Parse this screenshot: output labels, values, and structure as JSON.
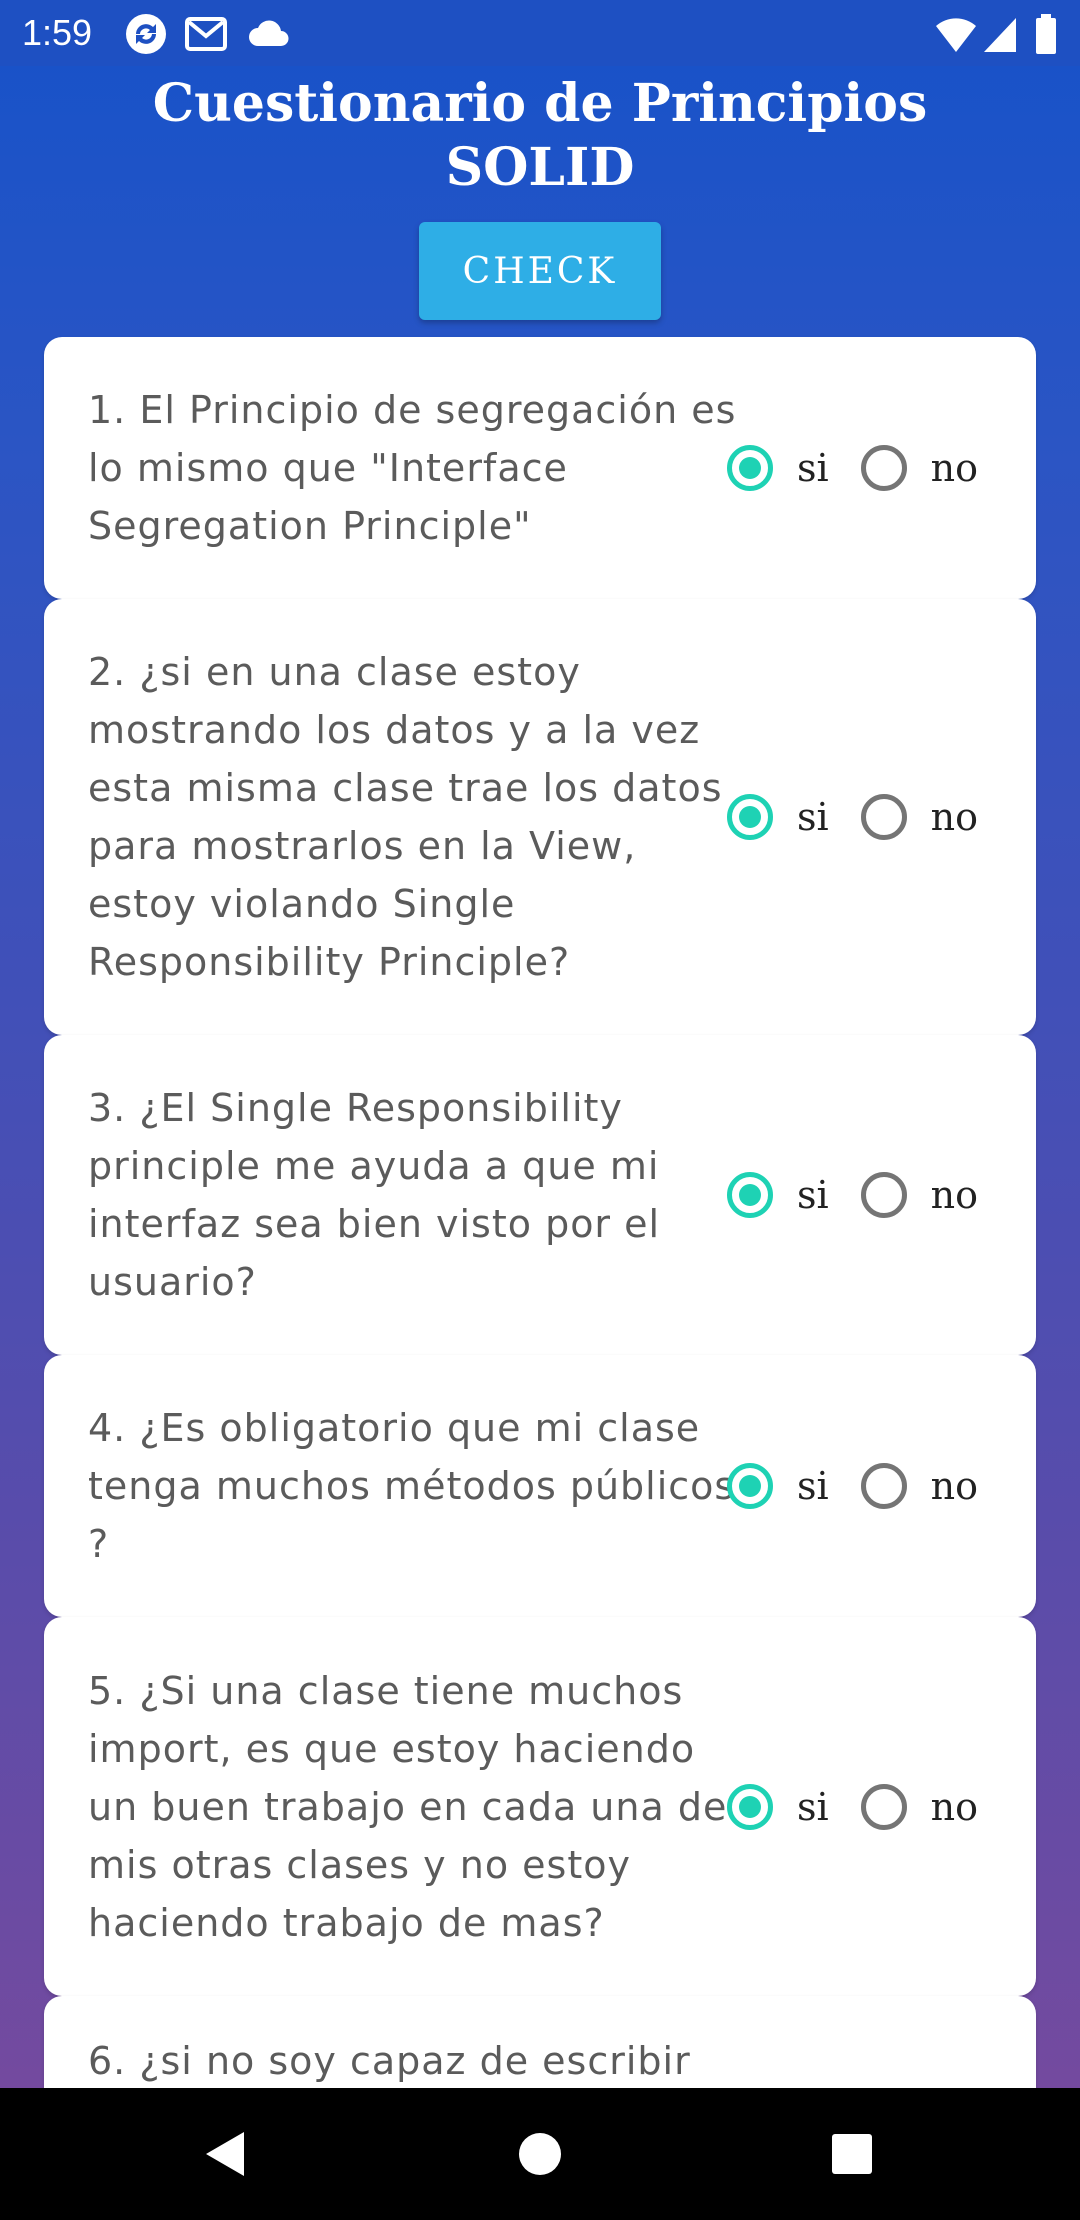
{
  "status_bar": {
    "time": "1:59",
    "left_icons": [
      "sync-app-icon",
      "gmail-icon",
      "cloud-icon"
    ],
    "right_icons": [
      "wifi-icon",
      "cell-signal-icon",
      "battery-icon"
    ]
  },
  "header": {
    "title_line1": "Cuestionario de Principios",
    "title_line2": "SOLID",
    "check_label": "CHECK"
  },
  "colors": {
    "accent_radio": "#1ed2b4",
    "check_button": "#2eaee6",
    "background_top": "#1652c9",
    "background_bottom": "#7a4a9c"
  },
  "questions": [
    {
      "text": "1. El Principio de segregación es lo mismo que \"Interface Segregation Principle\"",
      "yes_label": "si",
      "no_label": "no",
      "selected": "si"
    },
    {
      "text": "2. ¿si en una clase estoy mostrando los datos y a la vez esta misma clase trae los datos para mostrarlos en la View, estoy violando Single Responsibility Principle?",
      "yes_label": "si",
      "no_label": "no",
      "selected": "si"
    },
    {
      "text": "3. ¿El Single Responsibility principle me ayuda a que mi interfaz sea bien visto por el usuario?",
      "yes_label": "si",
      "no_label": "no",
      "selected": "si"
    },
    {
      "text": "4. ¿Es obligatorio que mi clase tenga muchos métodos públicos ?",
      "yes_label": "si",
      "no_label": "no",
      "selected": "si"
    },
    {
      "text": "5. ¿Si una clase tiene muchos import, es que estoy haciendo un buen trabajo en cada una de mis otras clases y no estoy haciendo trabajo de mas?",
      "yes_label": "si",
      "no_label": "no",
      "selected": "si"
    },
    {
      "text": "6. ¿si no soy capaz de escribir"
    }
  ],
  "nav_bar": {
    "buttons": [
      "back-icon",
      "home-icon",
      "recents-icon"
    ]
  }
}
